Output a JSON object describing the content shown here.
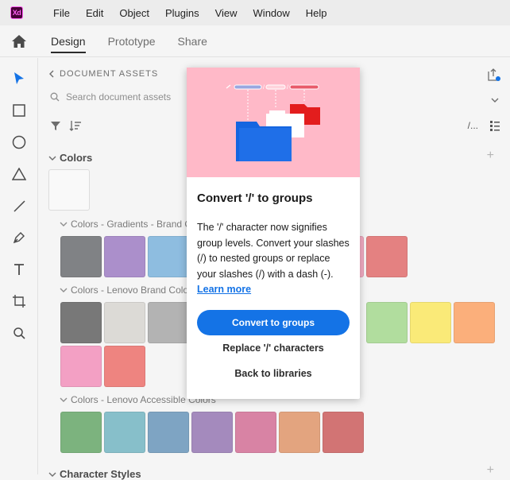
{
  "app": {
    "logo_text": "Xd",
    "brand_color": "#ff61f6"
  },
  "menu": {
    "items": [
      "File",
      "Edit",
      "Object",
      "Plugins",
      "View",
      "Window",
      "Help"
    ]
  },
  "tabs": [
    {
      "label": "Design",
      "active": true
    },
    {
      "label": "Prototype",
      "active": false
    },
    {
      "label": "Share",
      "active": false
    }
  ],
  "tools": [
    "select-icon",
    "rectangle-icon",
    "ellipse-icon",
    "triangle-icon",
    "line-icon",
    "pen-icon",
    "text-icon",
    "artboard-icon",
    "zoom-icon"
  ],
  "panel": {
    "header": "DOCUMENT ASSETS",
    "search_placeholder": "Search document assets",
    "view_label": "/...",
    "colors_title": "Colors",
    "groups": [
      {
        "title": "Colors - Gradients - Brand C",
        "colors": [
          "#808285",
          "#ab8fcb",
          "#8ebde0",
          "#c97ba7",
          "#f3acc3",
          "#e48181"
        ]
      },
      {
        "title": "Colors - Lenovo Brand Colo",
        "colors": [
          "#787878",
          "#dcdad6",
          "#b3b3b3",
          "#aedcd9",
          "#b1dd9e",
          "#faea78",
          "#fbaf7b",
          "#f3a0c4",
          "#ee8480"
        ]
      },
      {
        "title": "Colors - Lenovo Accessible Colors",
        "colors": [
          "#7cb37e",
          "#87bfca",
          "#7ea4c3",
          "#a48abd",
          "#d883a4",
          "#e3a47f",
          "#d27474"
        ]
      }
    ],
    "char_styles_title": "Character Styles"
  },
  "popup": {
    "title": "Convert '/' to groups",
    "body": "The '/' character now signifies group levels. Convert your slashes (/) to nested groups or replace your slashes (/) with a dash (-). ",
    "link": "Learn more",
    "primary_button": "Convert to groups",
    "replace_button": "Replace '/' characters",
    "back_button": "Back to libraries"
  }
}
